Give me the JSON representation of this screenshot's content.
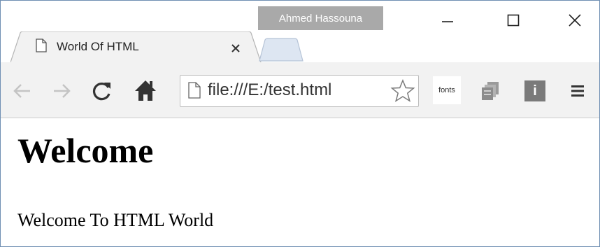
{
  "window": {
    "profile_name": "Ahmed Hassouna"
  },
  "tab": {
    "title": "World Of HTML",
    "icon": "page-icon",
    "close_icon": "close-icon"
  },
  "toolbar": {
    "back_icon": "back-arrow-icon",
    "forward_icon": "forward-arrow-icon",
    "reload_icon": "reload-icon",
    "home_icon": "home-icon",
    "url": "file:///E:/test.html",
    "bookmark_icon": "star-icon",
    "extensions": [
      {
        "name": "fonts-extension",
        "label": "fonts"
      },
      {
        "name": "copy-extension-icon"
      },
      {
        "name": "info-extension-icon",
        "label": "i"
      }
    ],
    "menu_icon": "hamburger-menu-icon"
  },
  "page": {
    "heading": "Welcome",
    "paragraph": "Welcome To HTML World"
  },
  "colors": {
    "window_border": "#6f8fb3",
    "toolbar_bg": "#f2f2f2",
    "profile_badge_bg": "#a9a9a9",
    "new_tab_fill": "#dde6f2"
  }
}
